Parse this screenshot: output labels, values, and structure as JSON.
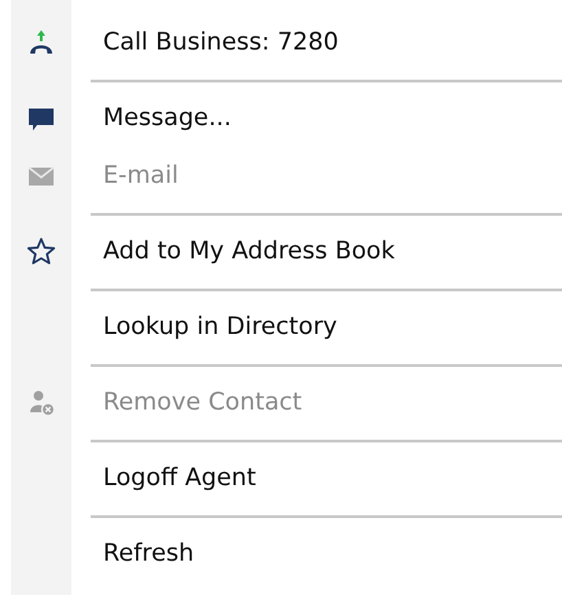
{
  "menu": {
    "sections": [
      {
        "items": [
          {
            "label": "Call Business: 7280",
            "kind": "call",
            "disabled": false
          }
        ]
      },
      {
        "items": [
          {
            "label": "Message...",
            "kind": "message",
            "disabled": false
          },
          {
            "label": "E-mail",
            "kind": "email",
            "disabled": true
          }
        ]
      },
      {
        "items": [
          {
            "label": "Add to My Address Book",
            "kind": "star",
            "disabled": false
          }
        ]
      },
      {
        "items": [
          {
            "label": "Lookup in Directory",
            "kind": "plain",
            "disabled": false
          }
        ]
      },
      {
        "items": [
          {
            "label": "Remove Contact",
            "kind": "remove-contact",
            "disabled": true
          }
        ]
      },
      {
        "items": [
          {
            "label": "Logoff Agent",
            "kind": "plain",
            "disabled": false
          }
        ]
      },
      {
        "items": [
          {
            "label": "Refresh",
            "kind": "plain",
            "disabled": false
          }
        ]
      }
    ]
  }
}
